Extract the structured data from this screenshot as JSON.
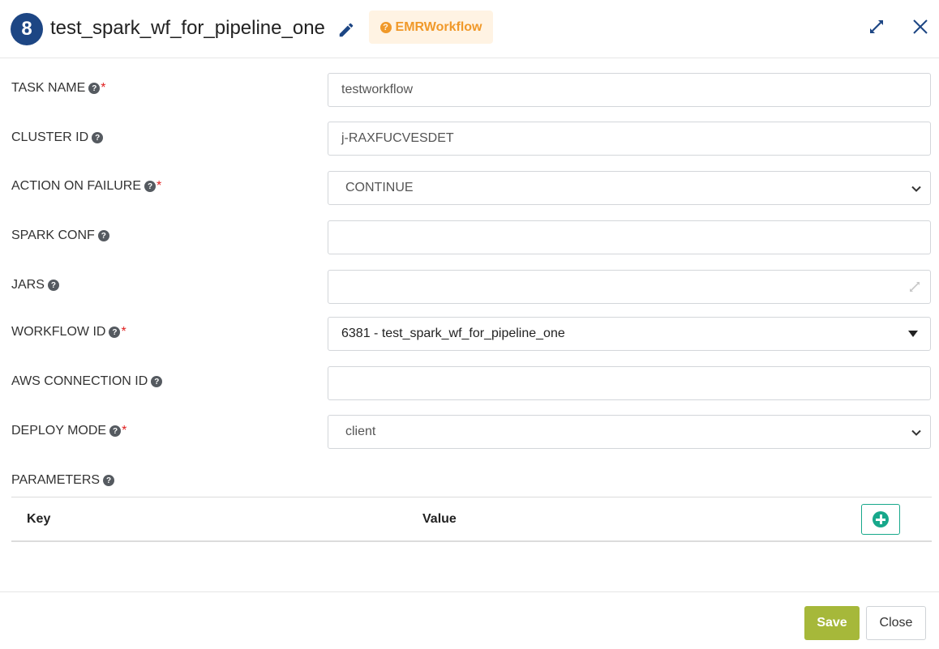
{
  "header": {
    "step_number": "8",
    "title": "test_spark_wf_for_pipeline_one",
    "type_badge": "EMRWorkflow",
    "icons": {
      "edit": "pencil-icon",
      "expand": "expand-arrows-icon",
      "close": "close-x-icon"
    }
  },
  "form": {
    "task_name": {
      "label": "TASK NAME",
      "required": "*",
      "value": "testworkflow"
    },
    "cluster_id": {
      "label": "CLUSTER ID",
      "value": "j-RAXFUCVESDET"
    },
    "action_on_failure": {
      "label": "ACTION ON FAILURE",
      "required": "*",
      "value": "CONTINUE"
    },
    "spark_conf": {
      "label": "SPARK CONF",
      "value": ""
    },
    "jars": {
      "label": "JARS",
      "value": ""
    },
    "workflow_id": {
      "label": "WORKFLOW ID",
      "required": "*",
      "value": "6381 - test_spark_wf_for_pipeline_one"
    },
    "aws_connection_id": {
      "label": "AWS CONNECTION ID",
      "value": ""
    },
    "deploy_mode": {
      "label": "DEPLOY MODE",
      "required": "*",
      "value": "client"
    }
  },
  "parameters": {
    "label": "PARAMETERS",
    "columns": [
      "Key",
      "Value"
    ]
  },
  "footer": {
    "save_label": "Save",
    "close_label": "Close"
  },
  "colors": {
    "badge_blue": "#1d4684",
    "type_orange": "#f0992a",
    "save_green": "#a6b83a",
    "add_teal": "#17a88b",
    "required_red": "#e02020"
  }
}
